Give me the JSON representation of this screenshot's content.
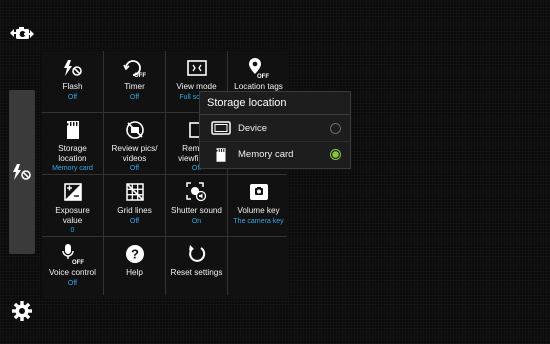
{
  "grid": [
    {
      "label": "Flash",
      "value": "Off",
      "icon": "flash-off-icon"
    },
    {
      "label": "Timer",
      "value": "Off",
      "icon": "timer-off-icon"
    },
    {
      "label": "View mode",
      "value": "Full screen",
      "icon": "view-mode-icon"
    },
    {
      "label": "Location tags",
      "value": "",
      "icon": "location-off-icon"
    },
    {
      "label": "Storage\nlocation",
      "value": "Memory card",
      "icon": "memory-card-icon"
    },
    {
      "label": "Review pics/\nvideos",
      "value": "Off",
      "icon": "review-off-icon"
    },
    {
      "label": "Remote\nviewfinder",
      "value": "Off",
      "icon": "remote-viewfinder-icon"
    },
    {
      "label": "",
      "value": "",
      "icon": ""
    },
    {
      "label": "Exposure\nvalue",
      "value": "0",
      "icon": "exposure-icon"
    },
    {
      "label": "Grid lines",
      "value": "Off",
      "icon": "grid-lines-icon"
    },
    {
      "label": "Shutter sound",
      "value": "On",
      "icon": "shutter-sound-icon"
    },
    {
      "label": "Volume key",
      "value": "The camera key",
      "icon": "camera-key-icon"
    },
    {
      "label": "Voice control",
      "value": "Off",
      "icon": "voice-control-off-icon"
    },
    {
      "label": "Help",
      "value": "",
      "icon": "help-icon"
    },
    {
      "label": "Reset settings",
      "value": "",
      "icon": "reset-icon"
    },
    {
      "label": "",
      "value": "",
      "icon": ""
    }
  ],
  "off_badge": "OFF",
  "popup": {
    "title": "Storage location",
    "options": [
      {
        "label": "Device",
        "selected": false
      },
      {
        "label": "Memory card",
        "selected": true
      }
    ]
  },
  "colors": {
    "value_text": "#36a8e6",
    "radio_selected": "#8ac43f"
  }
}
